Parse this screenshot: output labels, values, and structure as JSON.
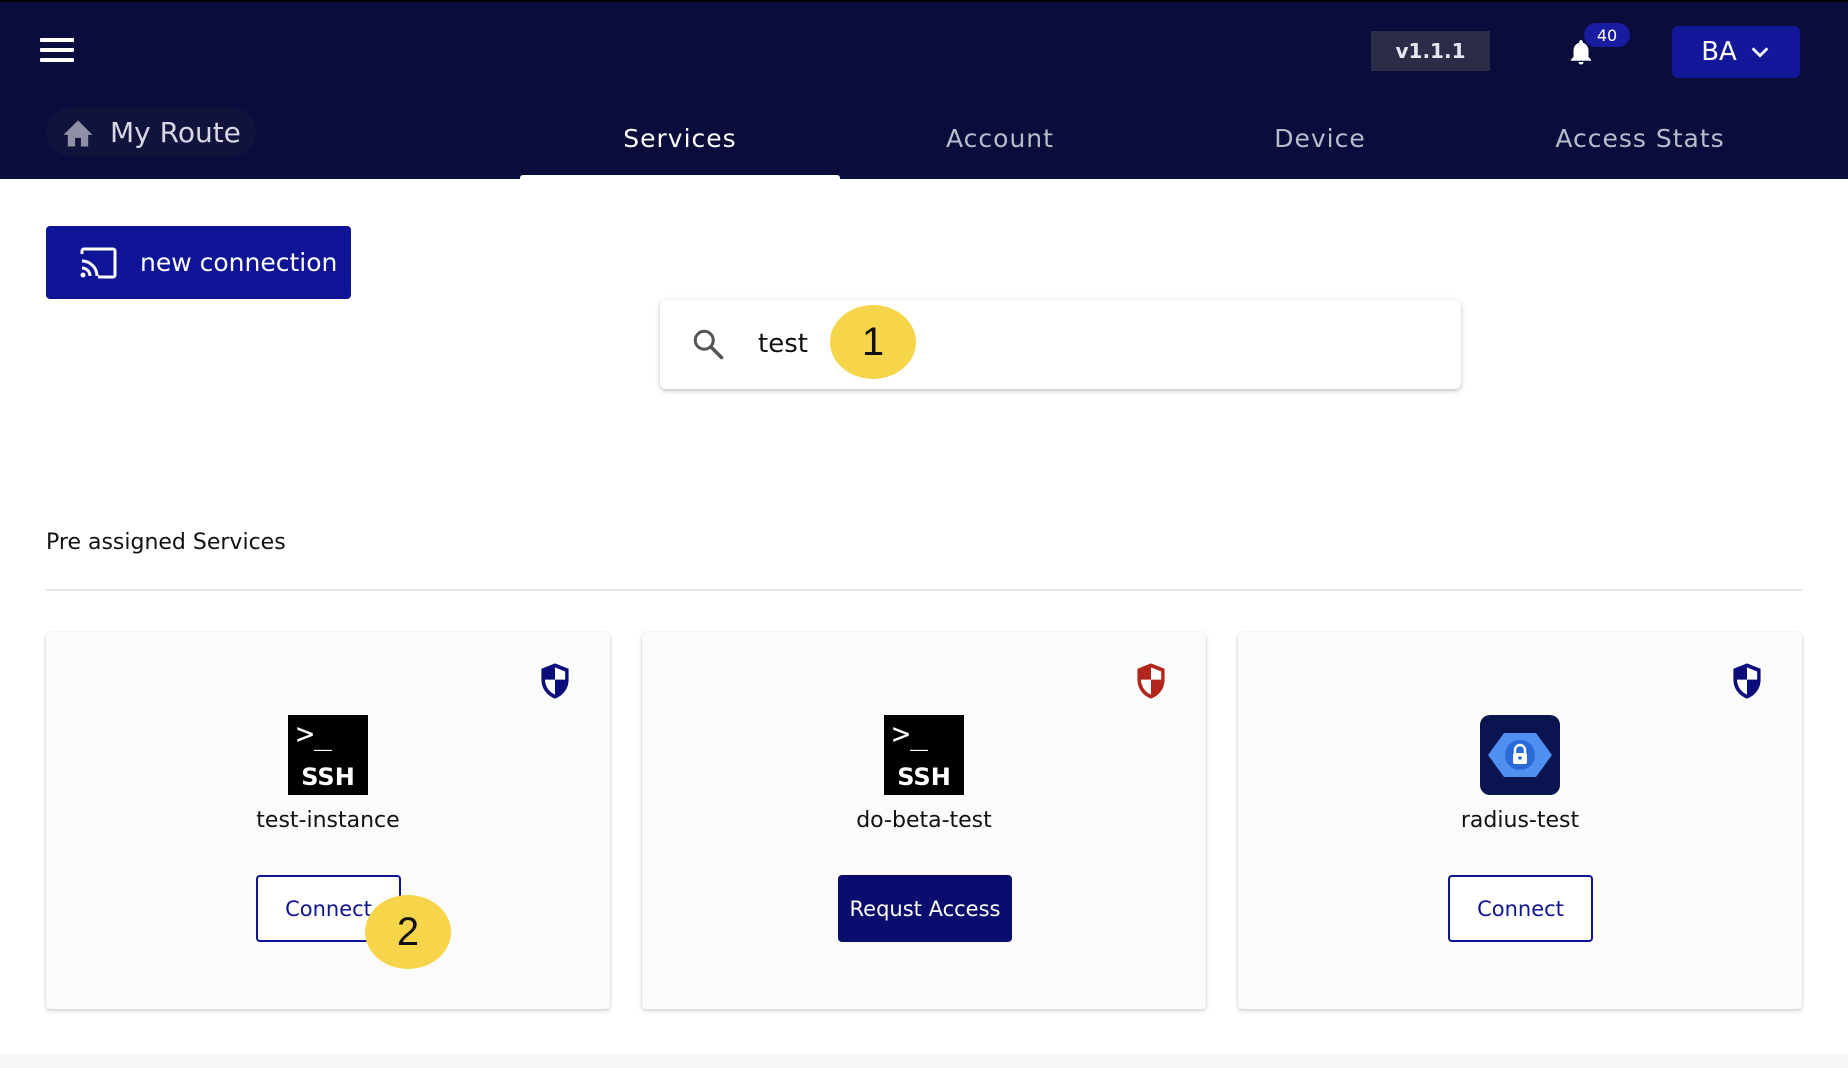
{
  "header": {
    "version": "v1.1.1",
    "notifications_count": "40",
    "user_initials": "BA",
    "brand_label": "My Route",
    "tabs": [
      {
        "label": "Services",
        "active": true
      },
      {
        "label": "Account",
        "active": false
      },
      {
        "label": "Device",
        "active": false
      },
      {
        "label": "Access Stats",
        "active": false
      }
    ]
  },
  "toolbar": {
    "new_connection_label": "new connection"
  },
  "search": {
    "value": "test"
  },
  "annotations": {
    "step1": "1",
    "step2": "2"
  },
  "section": {
    "title": "Pre assigned Services"
  },
  "services": [
    {
      "name": "test-instance",
      "icon": "ssh-icon",
      "shield_color": "#0a0c7a",
      "action": "Connect"
    },
    {
      "name": "do-beta-test",
      "icon": "ssh-icon",
      "shield_color": "#b3261e",
      "action": "Requst Access"
    },
    {
      "name": "radius-test",
      "icon": "radius-lock-icon",
      "shield_color": "#0a0c7a",
      "action": "Connect"
    }
  ],
  "icons": {
    "ssh_prompt": ">_",
    "ssh_label": "SSH"
  },
  "colors": {
    "header_bg": "#0a0c3c",
    "primary": "#0f1496",
    "badge": "#1a1ca0",
    "step_marker": "#f6d54b",
    "shield_alert": "#b3261e"
  }
}
